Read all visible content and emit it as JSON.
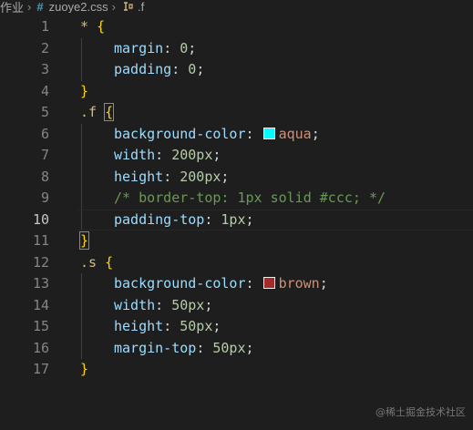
{
  "breadcrumb": {
    "folder": "作业",
    "file_icon": "hash-icon",
    "file_icon_text": "#",
    "file": "zuoye2.css",
    "symbol_icon": "css-selector-icon",
    "symbol": ".f"
  },
  "editor": {
    "current_line": 10,
    "lines": [
      {
        "n": "1",
        "indent": 0,
        "tokens": [
          [
            "sel",
            "* "
          ],
          [
            "brace",
            "{"
          ]
        ]
      },
      {
        "n": "2",
        "indent": 1,
        "tokens": [
          [
            "prop",
            "margin"
          ],
          [
            "punc",
            ": "
          ],
          [
            "num",
            "0"
          ],
          [
            "punc",
            ";"
          ]
        ]
      },
      {
        "n": "3",
        "indent": 1,
        "tokens": [
          [
            "prop",
            "padding"
          ],
          [
            "punc",
            ": "
          ],
          [
            "num",
            "0"
          ],
          [
            "punc",
            ";"
          ]
        ]
      },
      {
        "n": "4",
        "indent": 0,
        "tokens": [
          [
            "brace",
            "}"
          ]
        ]
      },
      {
        "n": "5",
        "indent": 0,
        "tokens": [
          [
            "sel",
            ".f "
          ],
          [
            "brace-box",
            "{"
          ]
        ]
      },
      {
        "n": "6",
        "indent": 1,
        "tokens": [
          [
            "prop",
            "background-color"
          ],
          [
            "punc",
            ": "
          ],
          [
            "swatch",
            "#00ffff"
          ],
          [
            "val",
            "aqua"
          ],
          [
            "punc",
            ";"
          ]
        ]
      },
      {
        "n": "7",
        "indent": 1,
        "tokens": [
          [
            "prop",
            "width"
          ],
          [
            "punc",
            ": "
          ],
          [
            "num",
            "200px"
          ],
          [
            "punc",
            ";"
          ]
        ]
      },
      {
        "n": "8",
        "indent": 1,
        "tokens": [
          [
            "prop",
            "height"
          ],
          [
            "punc",
            ": "
          ],
          [
            "num",
            "200px"
          ],
          [
            "punc",
            ";"
          ]
        ]
      },
      {
        "n": "9",
        "indent": 1,
        "tokens": [
          [
            "com",
            "/* border-top: 1px solid #ccc; */"
          ]
        ]
      },
      {
        "n": "10",
        "indent": 1,
        "tokens": [
          [
            "prop",
            "padding-top"
          ],
          [
            "punc",
            ": "
          ],
          [
            "num",
            "1px"
          ],
          [
            "punc",
            ";"
          ]
        ]
      },
      {
        "n": "11",
        "indent": 0,
        "tokens": [
          [
            "brace-box",
            "}"
          ]
        ]
      },
      {
        "n": "12",
        "indent": 0,
        "tokens": [
          [
            "sel",
            ".s "
          ],
          [
            "brace",
            "{"
          ]
        ]
      },
      {
        "n": "13",
        "indent": 1,
        "tokens": [
          [
            "prop",
            "background-color"
          ],
          [
            "punc",
            ": "
          ],
          [
            "swatch",
            "#a52a2a"
          ],
          [
            "val",
            "brown"
          ],
          [
            "punc",
            ";"
          ]
        ]
      },
      {
        "n": "14",
        "indent": 1,
        "tokens": [
          [
            "prop",
            "width"
          ],
          [
            "punc",
            ": "
          ],
          [
            "num",
            "50px"
          ],
          [
            "punc",
            ";"
          ]
        ]
      },
      {
        "n": "15",
        "indent": 1,
        "tokens": [
          [
            "prop",
            "height"
          ],
          [
            "punc",
            ": "
          ],
          [
            "num",
            "50px"
          ],
          [
            "punc",
            ";"
          ]
        ]
      },
      {
        "n": "16",
        "indent": 1,
        "tokens": [
          [
            "prop",
            "margin-top"
          ],
          [
            "punc",
            ": "
          ],
          [
            "num",
            "50px"
          ],
          [
            "punc",
            ";"
          ]
        ]
      },
      {
        "n": "17",
        "indent": 0,
        "tokens": [
          [
            "brace",
            "}"
          ]
        ]
      }
    ]
  },
  "watermark": "@稀土掘金技术社区"
}
